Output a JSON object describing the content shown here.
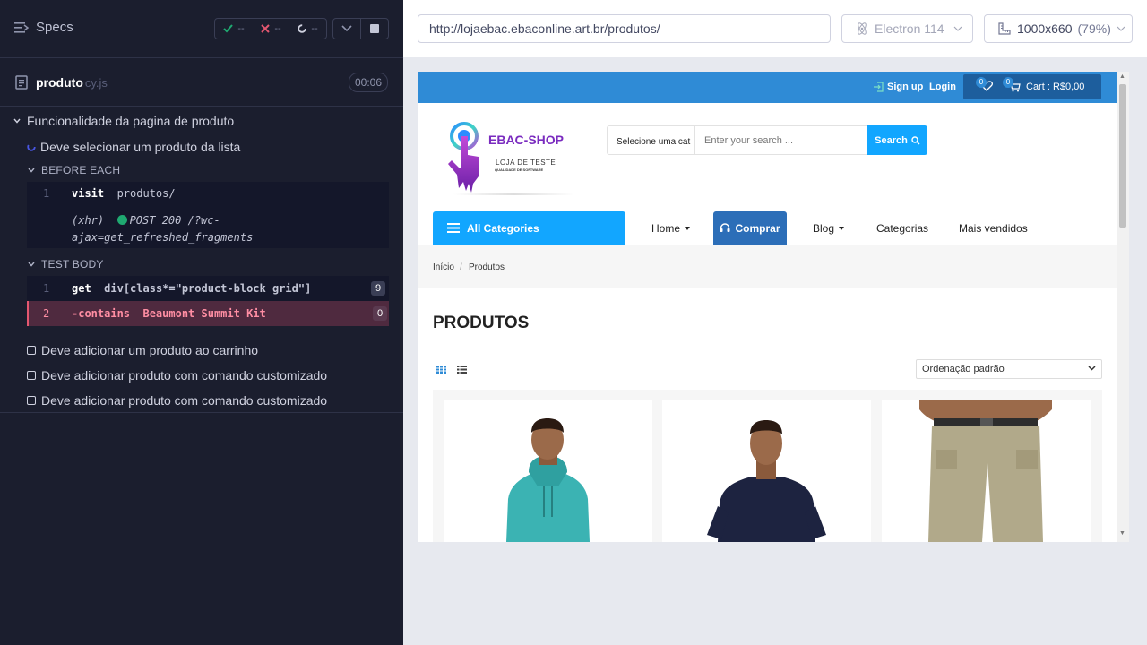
{
  "reporter": {
    "specs_label": "Specs",
    "stats": {
      "passed": "--",
      "failed": "--",
      "pending": "--"
    },
    "spec": {
      "name": "produto",
      "ext": "cy.js",
      "duration": "00:06"
    },
    "suite_title": "Funcionalidade da pagina de produto",
    "current_test": "Deve selecionar um produto da lista",
    "before_each_label": "BEFORE EACH",
    "before_each": [
      {
        "num": "1",
        "name": "visit",
        "message": "produtos/"
      }
    ],
    "xhr_line1": "(xhr)",
    "xhr_msg": "POST 200 /?wc-",
    "xhr_line2": "ajax=get_refreshed_fragments",
    "test_body_label": "TEST BODY",
    "test_body": [
      {
        "num": "1",
        "name": "get",
        "message": "div[class*=\"product-block grid\"]",
        "badge": "9"
      },
      {
        "num": "2",
        "name": "-contains",
        "message": "Beaumont Summit Kit",
        "badge": "0"
      }
    ],
    "other_tests": [
      "Deve adicionar um produto ao carrinho",
      "Deve adicionar produto com comando customizado",
      "Deve adicionar produto com comando customizado"
    ]
  },
  "toolbar": {
    "url": "http://lojaebac.ebaconline.art.br/produtos/",
    "browser": "Electron 114",
    "viewport": "1000x660",
    "scale": "(79%)"
  },
  "shop": {
    "signup": "Sign up",
    "login": "Login",
    "wishlist_count": "0",
    "cart_count": "0",
    "cart_text": "Cart : R$0,00",
    "logo_title": "EBAC-SHOP",
    "logo_sub": "LOJA DE TESTE",
    "logo_sub2": "QUALIDADE DE SOFTWARE",
    "search_category": "Selecione uma cat",
    "search_placeholder": "Enter your search ...",
    "search_button": "Search",
    "all_categories": "All Categories",
    "nav": {
      "home": "Home",
      "comprar": "Comprar",
      "blog": "Blog",
      "categorias": "Categorias",
      "mais_vendidos": "Mais vendidos"
    },
    "breadcrumb": [
      "Início",
      "Produtos"
    ],
    "page_title": "PRODUTOS",
    "sort_selected": "Ordenação padrão",
    "colors": {
      "topbar": "#2f8bd6",
      "accent": "#12a6ff",
      "comprar": "#2c6eb8",
      "logo": "#7a2bbf"
    }
  }
}
